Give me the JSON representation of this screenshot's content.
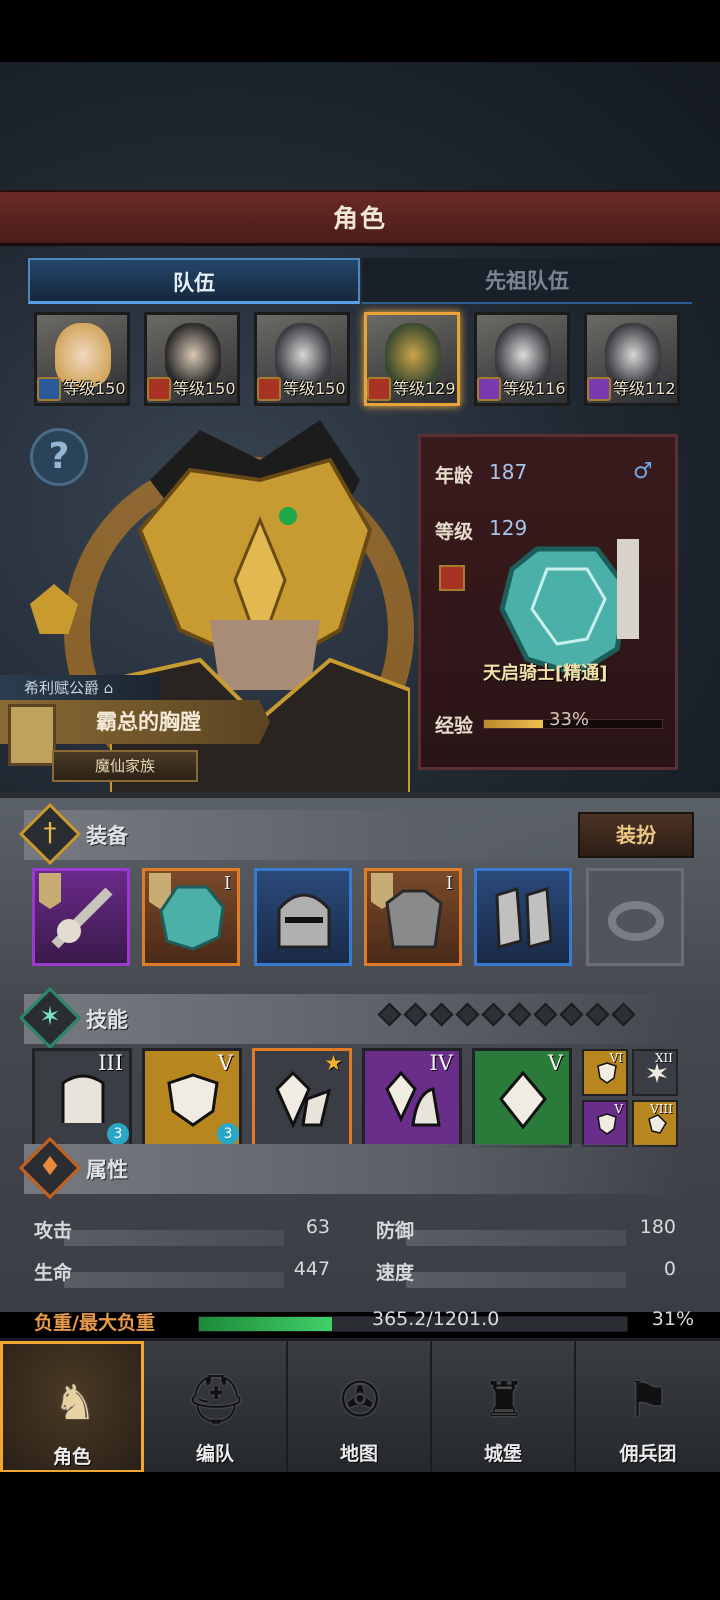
{
  "title": "角色",
  "tabs": [
    {
      "label": "队伍",
      "active": true
    },
    {
      "label": "先祖队伍",
      "active": false
    }
  ],
  "roster": [
    {
      "level_label": "等级150",
      "class_icon": "sword-icon",
      "selected": false
    },
    {
      "level_label": "等级150",
      "class_icon": "horse-icon",
      "selected": false
    },
    {
      "level_label": "等级150",
      "class_icon": "horse-icon",
      "selected": false
    },
    {
      "level_label": "等级129",
      "class_icon": "horse-icon",
      "selected": true
    },
    {
      "level_label": "等级116",
      "class_icon": "staff-icon",
      "selected": false
    },
    {
      "level_label": "等级112",
      "class_icon": "staff-icon",
      "selected": false
    }
  ],
  "hero": {
    "house": "希利赋公爵",
    "name": "霸总的胸膛",
    "family": "魔仙家族"
  },
  "info": {
    "age_label": "年龄",
    "age": "187",
    "gender": "♂",
    "level_label": "等级",
    "level": "129",
    "unit_name": "天启骑士[精通]",
    "exp_label": "经验",
    "exp_percent": "33%",
    "exp_fraction": 0.33
  },
  "equipment": {
    "title": "装备",
    "dress_button": "装扮",
    "slots": [
      {
        "icon": "staff-weapon-icon",
        "rank": "",
        "rarity": "purple"
      },
      {
        "icon": "shield-icon",
        "rank": "I",
        "rarity": "orange"
      },
      {
        "icon": "helmet-icon",
        "rank": "",
        "rarity": "blue"
      },
      {
        "icon": "armor-icon",
        "rank": "I",
        "rarity": "orange"
      },
      {
        "icon": "boots-icon",
        "rank": "",
        "rarity": "blue"
      },
      {
        "icon": "ring-icon",
        "rank": "",
        "rarity": "empty"
      }
    ]
  },
  "skills": {
    "title": "技能",
    "pip_count": 10,
    "main": [
      {
        "rank": "III",
        "badge": "3",
        "color": "#3a3e44"
      },
      {
        "rank": "V",
        "badge": "3",
        "color": "#b8861e"
      },
      {
        "rank": "",
        "badge": "",
        "color": "#3a3e44"
      },
      {
        "rank": "IV",
        "badge": "",
        "color": "#6a2e8a"
      },
      {
        "rank": "V",
        "badge": "",
        "color": "#2a7a3a"
      }
    ],
    "mini": [
      {
        "rank": "VI",
        "color": "#b8861e"
      },
      {
        "rank": "XII",
        "color": "#3a3e44"
      },
      {
        "rank": "V",
        "color": "#6a2e8a"
      },
      {
        "rank": "VIII",
        "color": "#b8861e"
      }
    ]
  },
  "attributes": {
    "title": "属性",
    "attack_label": "攻击",
    "attack": "63",
    "defense_label": "防御",
    "defense": "180",
    "hp_label": "生命",
    "hp": "447",
    "speed_label": "速度",
    "speed": "0",
    "load_label": "负重/最大负重",
    "load": "365.2/1201.0",
    "load_percent": "31%",
    "load_fraction": 0.31
  },
  "nav": [
    {
      "label": "角色",
      "icon": "knight-icon",
      "active": true
    },
    {
      "label": "编队",
      "icon": "helmet-icon",
      "active": false
    },
    {
      "label": "地图",
      "icon": "compass-icon",
      "active": false
    },
    {
      "label": "城堡",
      "icon": "castle-icon",
      "active": false
    },
    {
      "label": "佣兵团",
      "icon": "banner-icon",
      "active": false
    }
  ],
  "colors": {
    "accent": "#f0a832",
    "tab_active": "#4e86c0",
    "title_bar": "#6b2b26"
  }
}
